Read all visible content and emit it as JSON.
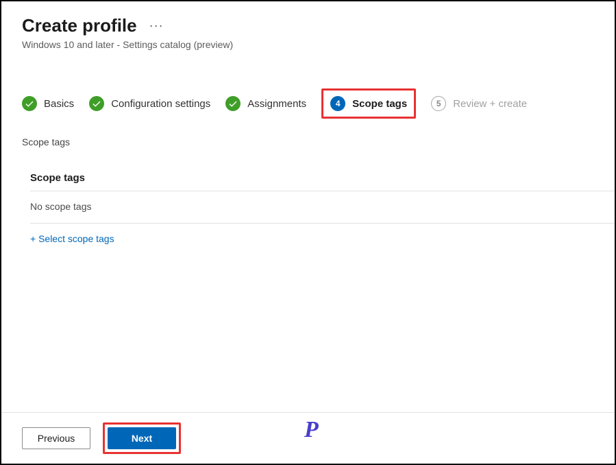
{
  "header": {
    "title": "Create profile",
    "subtitle": "Windows 10 and later - Settings catalog (preview)"
  },
  "steps": [
    {
      "num": "1",
      "label": "Basics",
      "state": "done"
    },
    {
      "num": "2",
      "label": "Configuration settings",
      "state": "done"
    },
    {
      "num": "3",
      "label": "Assignments",
      "state": "done"
    },
    {
      "num": "4",
      "label": "Scope tags",
      "state": "current"
    },
    {
      "num": "5",
      "label": "Review + create",
      "state": "pending"
    }
  ],
  "section": {
    "label": "Scope tags",
    "heading": "Scope tags",
    "empty": "No scope tags",
    "add_link": "+ Select scope tags"
  },
  "footer": {
    "previous": "Previous",
    "next": "Next"
  },
  "logo": "P"
}
